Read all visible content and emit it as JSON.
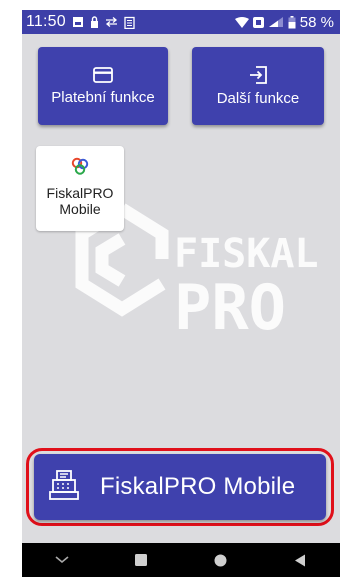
{
  "status_bar": {
    "time": "11:50",
    "battery_percent": "58 %",
    "icons": [
      "gallery-icon",
      "lock-icon",
      "transfer-icon",
      "clipboard-icon",
      "wifi-icon",
      "data-icon",
      "signal-icon",
      "battery-icon"
    ]
  },
  "buttons": {
    "platebni_label": "Platební funkce",
    "dalsi_label": "Další funkce"
  },
  "tile": {
    "label": "FiskalPRO\nMobile"
  },
  "main_button": {
    "label": "FiskalPRO Mobile"
  },
  "watermark": {
    "line1": "FISKAL",
    "line2": "PRO"
  },
  "colors": {
    "primary": "#3f41ad",
    "status_bar": "#3d3fa8",
    "background": "#dcdcdf",
    "highlight": "#e0101a"
  }
}
